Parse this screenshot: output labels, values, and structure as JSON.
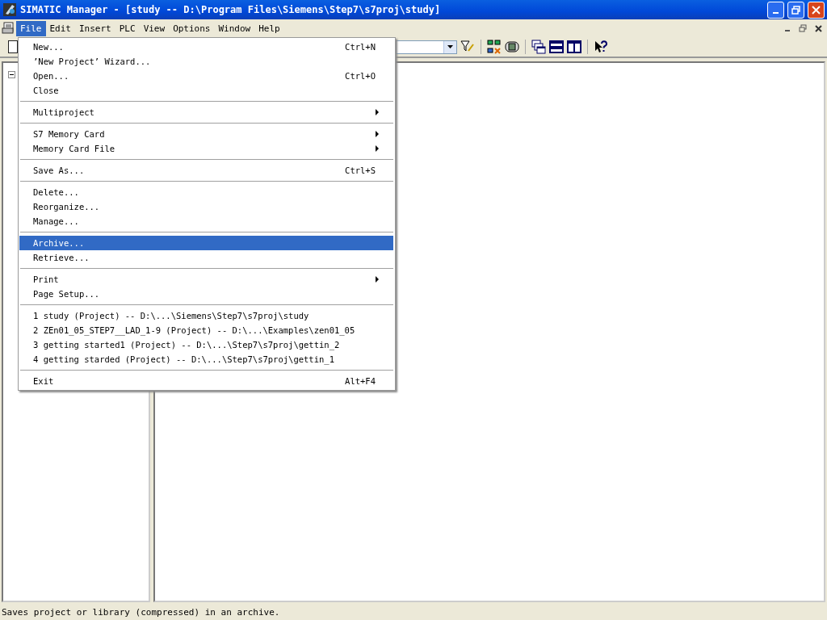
{
  "window": {
    "title": "SIMATIC Manager - [study -- D:\\Program Files\\Siemens\\Step7\\s7proj\\study]"
  },
  "menu_bar": [
    {
      "label": "File",
      "selected": true
    },
    {
      "label": "Edit",
      "selected": false
    },
    {
      "label": "Insert",
      "selected": false
    },
    {
      "label": "PLC",
      "selected": false
    },
    {
      "label": "View",
      "selected": false
    },
    {
      "label": "Options",
      "selected": false
    },
    {
      "label": "Window",
      "selected": false
    },
    {
      "label": "Help",
      "selected": false
    }
  ],
  "file_menu": [
    {
      "kind": "item",
      "label": "New...",
      "shortcut": "Ctrl+N",
      "submenu": false,
      "selected": false
    },
    {
      "kind": "item",
      "label": "’New Project’ Wizard...",
      "submenu": false,
      "selected": false
    },
    {
      "kind": "item",
      "label": "Open...",
      "shortcut": "Ctrl+O",
      "submenu": false,
      "selected": false
    },
    {
      "kind": "item",
      "label": "Close",
      "submenu": false,
      "selected": false
    },
    {
      "kind": "separator"
    },
    {
      "kind": "item",
      "label": "Multiproject",
      "submenu": true,
      "selected": false
    },
    {
      "kind": "separator"
    },
    {
      "kind": "item",
      "label": "S7 Memory Card",
      "submenu": true,
      "selected": false
    },
    {
      "kind": "item",
      "label": "Memory Card File",
      "submenu": true,
      "selected": false
    },
    {
      "kind": "separator"
    },
    {
      "kind": "item",
      "label": "Save As...",
      "shortcut": "Ctrl+S",
      "submenu": false,
      "selected": false
    },
    {
      "kind": "separator"
    },
    {
      "kind": "item",
      "label": "Delete...",
      "submenu": false,
      "selected": false
    },
    {
      "kind": "item",
      "label": "Reorganize...",
      "submenu": false,
      "selected": false
    },
    {
      "kind": "item",
      "label": "Manage...",
      "submenu": false,
      "selected": false
    },
    {
      "kind": "separator"
    },
    {
      "kind": "item",
      "label": "Archive...",
      "submenu": false,
      "selected": true
    },
    {
      "kind": "item",
      "label": "Retrieve...",
      "submenu": false,
      "selected": false
    },
    {
      "kind": "separator"
    },
    {
      "kind": "item",
      "label": "Print",
      "submenu": true,
      "selected": false
    },
    {
      "kind": "item",
      "label": "Page Setup...",
      "submenu": false,
      "selected": false
    },
    {
      "kind": "separator"
    },
    {
      "kind": "item",
      "label": "1 study (Project) -- D:\\...\\Siemens\\Step7\\s7proj\\study",
      "submenu": false,
      "selected": false
    },
    {
      "kind": "item",
      "label": "2 ZEn01_05_STEP7__LAD_1-9 (Project) -- D:\\...\\Examples\\zen01_05",
      "submenu": false,
      "selected": false
    },
    {
      "kind": "item",
      "label": "3 getting started1 (Project) -- D:\\...\\Step7\\s7proj\\gettin_2",
      "submenu": false,
      "selected": false
    },
    {
      "kind": "item",
      "label": "4 getting starded (Project) -- D:\\...\\Step7\\s7proj\\gettin_1",
      "submenu": false,
      "selected": false
    },
    {
      "kind": "separator"
    },
    {
      "kind": "item",
      "label": "Exit",
      "shortcut": "Alt+F4",
      "submenu": false,
      "selected": false
    }
  ],
  "status_bar": {
    "text": "Saves project or library (compressed) in an archive."
  }
}
